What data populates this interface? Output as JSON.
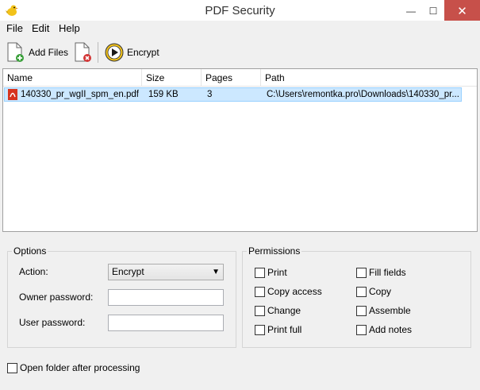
{
  "window": {
    "title": "PDF Security",
    "minimize": "—",
    "maximize": "☐",
    "close": "✕"
  },
  "menu": [
    {
      "label": "File"
    },
    {
      "label": "Edit"
    },
    {
      "label": "Help"
    }
  ],
  "toolbar": {
    "add_files_label": "Add Files",
    "remove_icon": "remove-file-icon",
    "encrypt_label": "Encrypt"
  },
  "file_list": {
    "columns": [
      "Name",
      "Size",
      "Pages",
      "Path"
    ],
    "rows": [
      {
        "name": "140330_pr_wgII_spm_en.pdf",
        "size": "159 KB",
        "pages": "3",
        "path": "C:\\Users\\remontka.pro\\Downloads\\140330_pr..."
      }
    ]
  },
  "options": {
    "group_label": "Options",
    "action_label": "Action:",
    "action_value": "Encrypt",
    "owner_password_label": "Owner password:",
    "owner_password_value": "",
    "user_password_label": "User password:",
    "user_password_value": ""
  },
  "permissions": {
    "group_label": "Permissions",
    "items": [
      {
        "label": "Print",
        "checked": false
      },
      {
        "label": "Fill fields",
        "checked": false
      },
      {
        "label": "Copy access",
        "checked": false
      },
      {
        "label": "Copy",
        "checked": false
      },
      {
        "label": "Change",
        "checked": false
      },
      {
        "label": "Assemble",
        "checked": false
      },
      {
        "label": "Print full",
        "checked": false
      },
      {
        "label": "Add notes",
        "checked": false
      }
    ]
  },
  "footer": {
    "open_folder_label": "Open folder after processing",
    "open_folder_checked": false
  }
}
